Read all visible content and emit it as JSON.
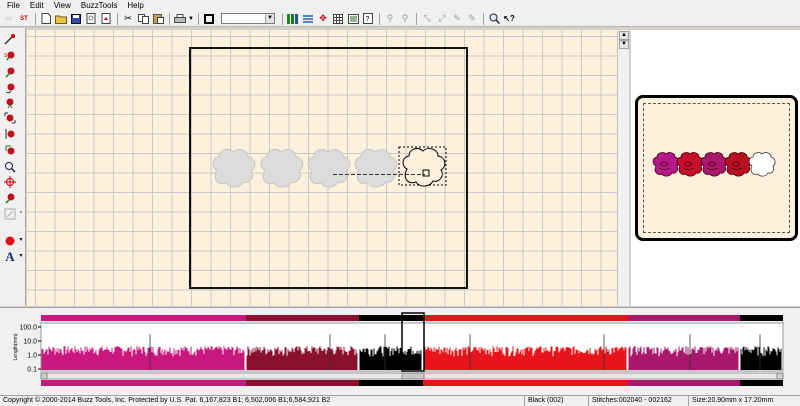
{
  "menu": [
    "File",
    "Edit",
    "View",
    "BuzzTools",
    "Help"
  ],
  "toolbar": {
    "items": [
      "bzi-icon",
      "st-icon",
      "new-file-icon",
      "open-folder-icon",
      "save-icon",
      "print-preview-icon",
      "import-icon",
      "cut-icon",
      "copy-icon",
      "paste-icon",
      "printer-icon",
      "hoop-icon",
      "zoom-combo",
      "color-bars-icon",
      "split-icon",
      "move-icon",
      "grid-icon",
      "stitch-list-icon",
      "wand-icon",
      "wand-alt-icon",
      "select-icon",
      "select-alt-icon",
      "brush-icon",
      "brush-alt-icon",
      "zoom-icon",
      "help-pointer-icon"
    ],
    "st_label": "ST",
    "zoom_value": ""
  },
  "left_tools": [
    "view-wand-icon",
    "rose-design-icon",
    "rose-move-icon",
    "rose-rotate-icon",
    "rose-add-icon",
    "rose-scale-icon",
    "rose-mirror-icon",
    "rose-stack-icon",
    "magnify-icon",
    "crosshair-icon",
    "rose-cut-icon",
    "outline-select-icon",
    "color-dot-icon",
    "text-tool-icon"
  ],
  "text_tool_label": "A",
  "analysis": {
    "ytick_labels": [
      "100.0",
      "10.0",
      "1.0",
      "0.1"
    ],
    "ylabel": "Length(mm)"
  },
  "colors": {
    "magenta": "#c8187e",
    "burgundy": "#8a1030",
    "black": "#000000",
    "red": "#e8141c",
    "rose": "#a8186c",
    "canvas": "#fdf0dc",
    "cloud_fill": "#dcdcdc",
    "cloud_stroke": "#c4c4c4"
  },
  "preview": {
    "roses": [
      "#b51a8c",
      "#c8102a",
      "#a8186c",
      "#b8101e",
      "#ffffff"
    ]
  },
  "status": {
    "copyright": "Copyright © 2000-2014 Buzz Tools, Inc. Protected by U.S. Pat. 6,167,823 B1; 6,502,006 B1;6,584,921 B2",
    "color": "Black (002)",
    "stitches": "Stitches:002040 - 002162",
    "size": "Size:20.90mm x 17.20mm"
  }
}
